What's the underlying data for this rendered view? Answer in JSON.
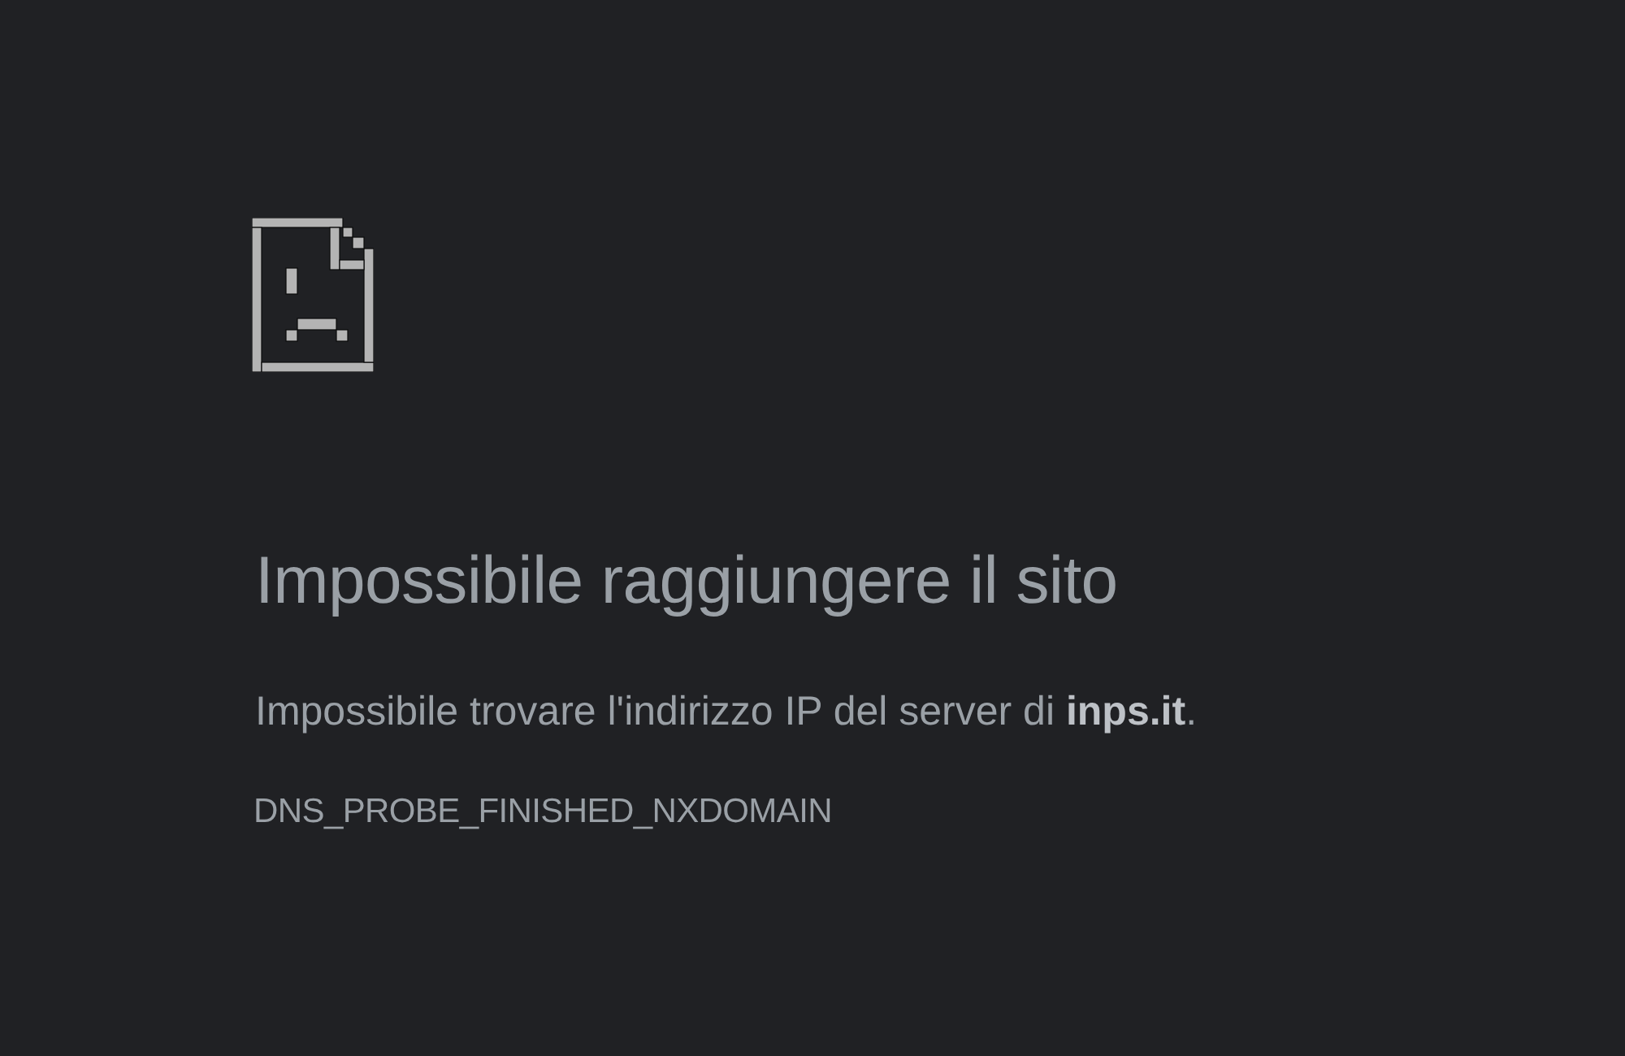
{
  "error": {
    "title": "Impossibile raggiungere il sito",
    "message": "Impossibile trovare l'indirizzo IP del server di **inps.it**.",
    "code": "DNS_PROBE_FINISHED_NXDOMAIN"
  }
}
